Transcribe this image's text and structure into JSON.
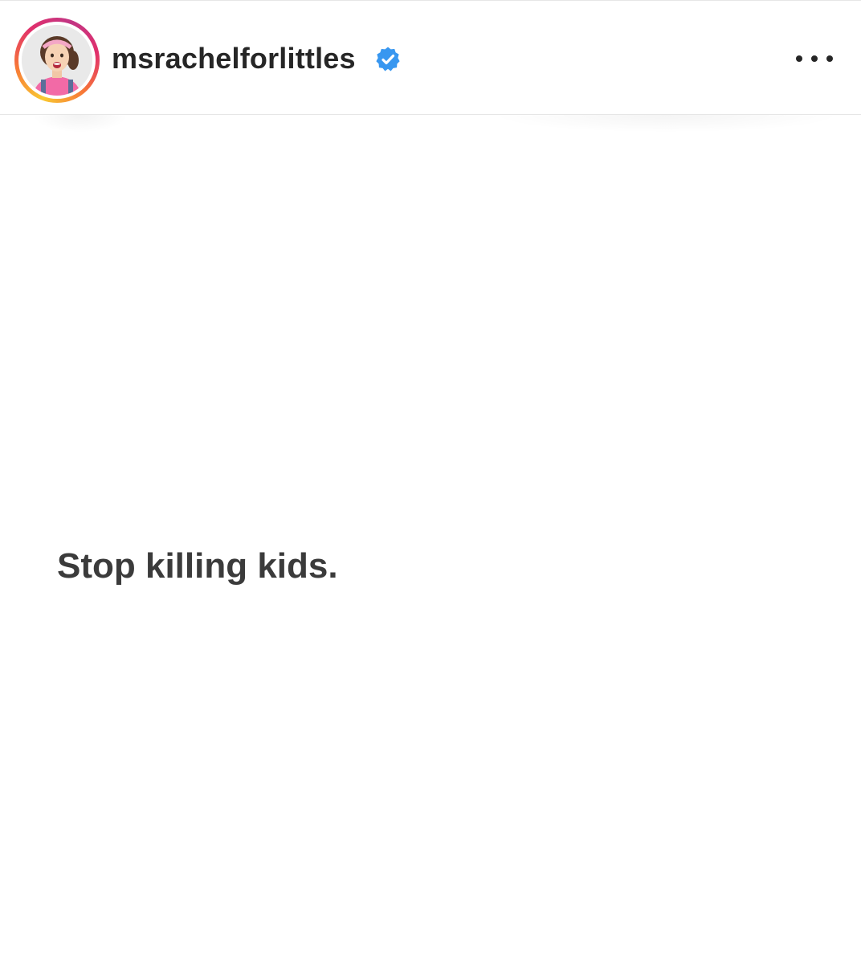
{
  "header": {
    "username": "msrachelforlittles",
    "verified_icon": "verified-badge-icon",
    "verified_color": "#3897f0",
    "more_icon": "more-options-icon",
    "avatar_ring_colors": [
      "#f9c932",
      "#f77737",
      "#e1306c",
      "#c13584"
    ]
  },
  "post": {
    "text": "Stop killing kids.",
    "text_color": "#3b3b3b",
    "background": "#ffffff"
  }
}
